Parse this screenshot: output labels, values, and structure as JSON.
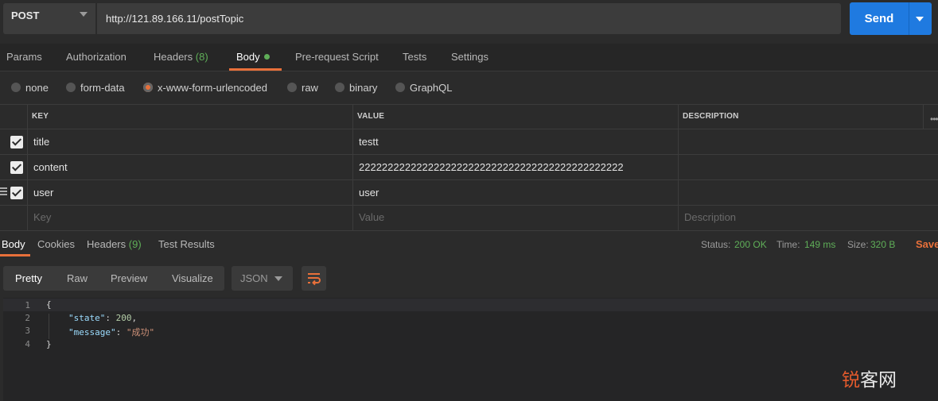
{
  "request": {
    "method": "POST",
    "url": "http://121.89.166.11/postTopic",
    "send_label": "Send"
  },
  "request_tabs": {
    "params": "Params",
    "authorization": "Authorization",
    "headers": "Headers",
    "headers_count": "(8)",
    "body": "Body",
    "pre_request": "Pre-request Script",
    "tests": "Tests",
    "settings": "Settings"
  },
  "body_types": [
    "none",
    "form-data",
    "x-www-form-urlencoded",
    "raw",
    "binary",
    "GraphQL"
  ],
  "body_type_selected": "x-www-form-urlencoded",
  "table": {
    "headers": [
      "KEY",
      "VALUE",
      "DESCRIPTION"
    ],
    "rows": [
      {
        "checked": true,
        "key": "title",
        "value": "testt",
        "description": ""
      },
      {
        "checked": true,
        "key": "content",
        "value": "2222222222222222222222222222222222222222222222",
        "description": ""
      },
      {
        "checked": true,
        "key": "user",
        "value": "user",
        "description": ""
      }
    ],
    "placeholder": {
      "key": "Key",
      "value": "Value",
      "description": "Description"
    }
  },
  "response_tabs": {
    "body": "Body",
    "cookies": "Cookies",
    "headers": "Headers",
    "headers_count": "(9)",
    "test_results": "Test Results"
  },
  "response_status": {
    "status_label": "Status:",
    "status": "200 OK",
    "time_label": "Time:",
    "time": "149 ms",
    "size_label": "Size:",
    "size": "320 B",
    "save": "Save"
  },
  "view_modes": {
    "pretty": "Pretty",
    "raw": "Raw",
    "preview": "Preview",
    "visualize": "Visualize",
    "format": "JSON"
  },
  "code": {
    "line_numbers": [
      "1",
      "2",
      "3",
      "4"
    ],
    "open_brace": "{",
    "close_brace": "}",
    "state_key": "\"state\"",
    "state_value": "200",
    "message_key": "\"message\"",
    "message_value": "\"成功\""
  },
  "watermark": {
    "part1": "锐",
    "part2": "客网"
  },
  "colors": {
    "accent": "#e8703a",
    "primary_button": "#1f7ae0",
    "success": "#5fae58",
    "background": "#2b2b2b"
  },
  "icons": [
    "chevron-down-icon",
    "checkbox-icon",
    "drag-handle-icon",
    "more-icon",
    "wrap-lines-icon"
  ]
}
